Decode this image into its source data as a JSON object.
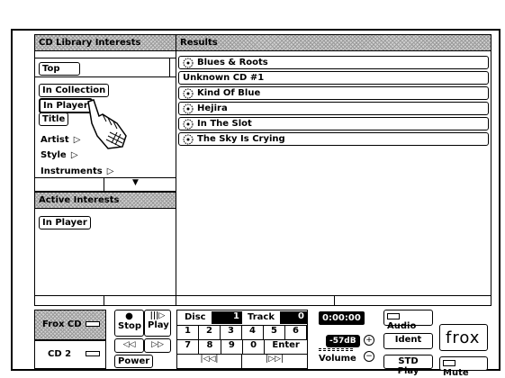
{
  "library": {
    "header": "CD Library Interests",
    "top_button": "Top",
    "items": [
      {
        "label": "In Collection",
        "kind": "button"
      },
      {
        "label": "In Player",
        "kind": "button-selected"
      },
      {
        "label": "Title",
        "kind": "button"
      },
      {
        "label": "Artist",
        "kind": "expand"
      },
      {
        "label": "Style",
        "kind": "expand"
      },
      {
        "label": "Instruments",
        "kind": "expand"
      }
    ]
  },
  "active": {
    "header": "Active Interests",
    "items": [
      "In Player"
    ]
  },
  "results": {
    "header": "Results",
    "items": [
      {
        "label": "Blues & Roots",
        "icon": true
      },
      {
        "label": "Unknown CD #1",
        "icon": false
      },
      {
        "label": "Kind Of Blue",
        "icon": true
      },
      {
        "label": "Hejira",
        "icon": true
      },
      {
        "label": "In The Slot",
        "icon": true
      },
      {
        "label": "The Sky Is Crying",
        "icon": true
      }
    ]
  },
  "player": {
    "sources": [
      "Frox CD",
      "CD 2"
    ],
    "stop": "Stop",
    "play": "Play",
    "power": "Power",
    "disc_label": "Disc",
    "disc_value": "1",
    "track_label": "Track",
    "track_value": "0",
    "keypad_row1": [
      "1",
      "2",
      "3",
      "4",
      "5",
      "6"
    ],
    "keypad_row2": [
      "7",
      "8",
      "9",
      "0"
    ],
    "enter": "Enter",
    "time": "0:00:00",
    "db": "-57dB",
    "volume": "Volume",
    "audio": "Audio",
    "ident": "Ident",
    "std_play": "STD Play",
    "mute": "Mute",
    "logo": "frox"
  }
}
